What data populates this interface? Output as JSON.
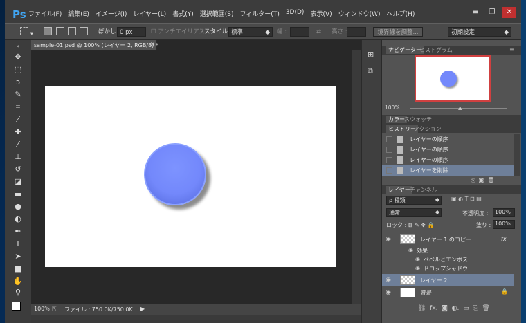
{
  "app": {
    "logo": "Ps"
  },
  "menu": [
    "ファイル(F)",
    "編集(E)",
    "イメージ(I)",
    "レイヤー(L)",
    "書式(Y)",
    "選択範囲(S)",
    "フィルター(T)",
    "3D(D)",
    "表示(V)",
    "ウィンドウ(W)",
    "ヘルプ(H)"
  ],
  "window_controls": {
    "minimize": "▬",
    "restore": "❐",
    "close": "✕"
  },
  "options": {
    "feather_label": "ぼかし :",
    "feather_value": "0 px",
    "antialias_label": "アンチエイリアス",
    "style_label": "スタイル :",
    "style_value": "標準",
    "width_label": "幅 :",
    "height_label": "高さ :",
    "refine_edge": "境界線を調整...",
    "workspace": "初期設定"
  },
  "document": {
    "tab_title": "sample-01.psd @ 100% (レイヤー 2, RGB/8) *",
    "zoom": "100%",
    "file_info": "ファイル : 750.0K/750.0K"
  },
  "navigator": {
    "tab_navigator": "ナビゲーター",
    "tab_histogram": "ヒストグラム",
    "zoom": "100%"
  },
  "color_panel": {
    "tab_color": "カラー",
    "tab_swatches": "スウォッチ"
  },
  "history_panel": {
    "tab_history": "ヒストリー",
    "tab_actions": "アクション",
    "items": [
      "レイヤーの順序",
      "レイヤーの順序",
      "レイヤーの順序",
      "レイヤーを削除"
    ]
  },
  "layers_panel": {
    "tab_layers": "レイヤー",
    "tab_channels": "チャンネル",
    "filter_kind": "ρ 種類",
    "blend_mode": "通常",
    "opacity_label": "不透明度 :",
    "opacity_value": "100%",
    "lock_label": "ロック :",
    "fill_label": "塗り :",
    "fill_value": "100%",
    "layers": [
      {
        "name": "レイヤー 1 のコピー",
        "fx": "fx"
      },
      {
        "name": "効果"
      },
      {
        "name": "ベベルとエンボス"
      },
      {
        "name": "ドロップシャドウ"
      },
      {
        "name": "レイヤー 2"
      },
      {
        "name": "背景"
      }
    ]
  },
  "colors": {
    "accent_circle": "#7388fb",
    "selected_row": "#6e7f99",
    "nav_frame": "#d04040"
  }
}
